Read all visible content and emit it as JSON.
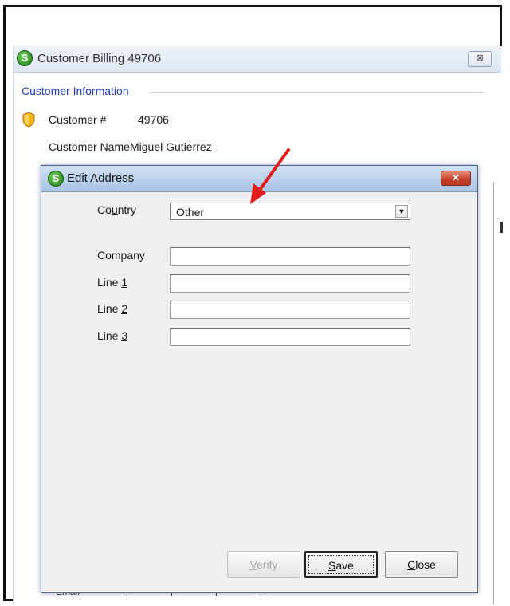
{
  "background_window": {
    "title": "Customer Billing 49706",
    "close_glyph": "⊠",
    "section_header": "Customer Information",
    "customer_number_label": "Customer #",
    "customer_number_value": "49706",
    "customer_name_label": "Customer Name",
    "customer_name_value": "Miguel Gutierrez",
    "email_label": "Email"
  },
  "dialog": {
    "title": "Edit Address",
    "close_glyph": "✕",
    "country": {
      "label_pre": "Co",
      "label_u": "u",
      "label_post": "ntry",
      "value": "Other",
      "arrow": "▼"
    },
    "company": {
      "label": "Company",
      "value": ""
    },
    "line1": {
      "label_pre": "Line ",
      "label_u": "1",
      "value": ""
    },
    "line2": {
      "label_pre": "Line ",
      "label_u": "2",
      "value": ""
    },
    "line3": {
      "label_pre": "Line ",
      "label_u": "3",
      "value": ""
    },
    "buttons": {
      "verify": {
        "u": "V",
        "rest": "erify"
      },
      "save": {
        "u": "S",
        "rest": "ave"
      },
      "close": {
        "u": "C",
        "rest": "lose"
      }
    }
  },
  "icons": {
    "app_icon_letter": "S"
  },
  "colors": {
    "section_header": "#1f3bb5",
    "annotation_arrow": "#e01c1c",
    "dialog_close": "#c2412a"
  }
}
